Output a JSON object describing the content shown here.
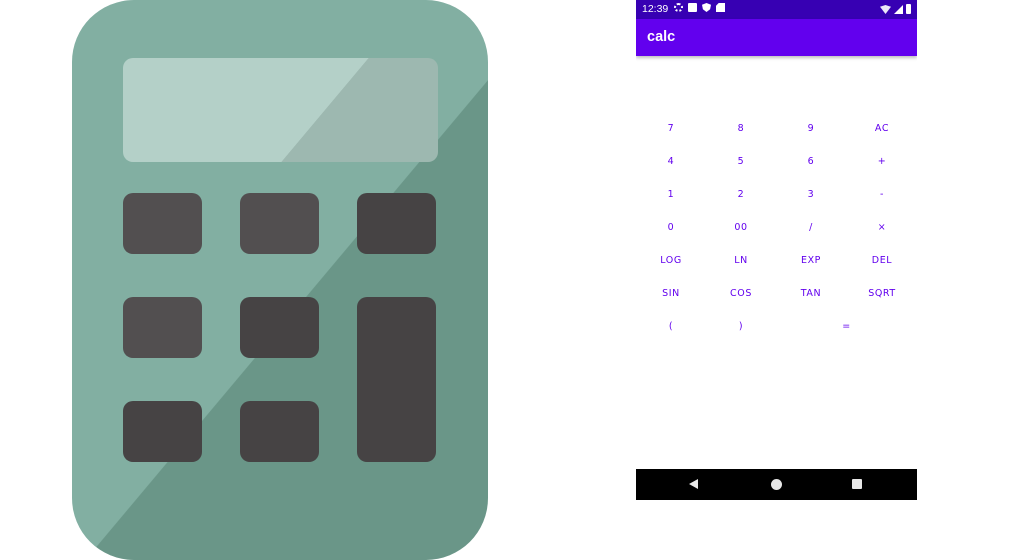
{
  "status_bar": {
    "time": "12:39",
    "left_icons": [
      "gear-icon",
      "download-box-icon",
      "shield-icon",
      "sd-card-icon"
    ],
    "right_icons": [
      "wifi-icon",
      "signal-icon",
      "battery-icon"
    ]
  },
  "app_bar": {
    "title": "calc"
  },
  "keypad": {
    "rows": [
      [
        "7",
        "8",
        "9",
        "AC"
      ],
      [
        "4",
        "5",
        "6",
        "+"
      ],
      [
        "1",
        "2",
        "3",
        "-"
      ],
      [
        "0",
        "00",
        "/",
        "×"
      ],
      [
        "LOG",
        "LN",
        "EXP",
        "DEL"
      ],
      [
        "SIN",
        "COS",
        "TAN",
        "SQRT"
      ],
      [
        "(",
        ")",
        "="
      ]
    ]
  },
  "nav_bar": {
    "icons": [
      "back-icon",
      "home-icon",
      "recents-icon"
    ]
  },
  "colors": {
    "status_bar": "#3700b3",
    "app_bar": "#6200ee",
    "key_text": "#6200ee",
    "illustration_body": "#82afa2",
    "illustration_keys": "#524f50"
  }
}
